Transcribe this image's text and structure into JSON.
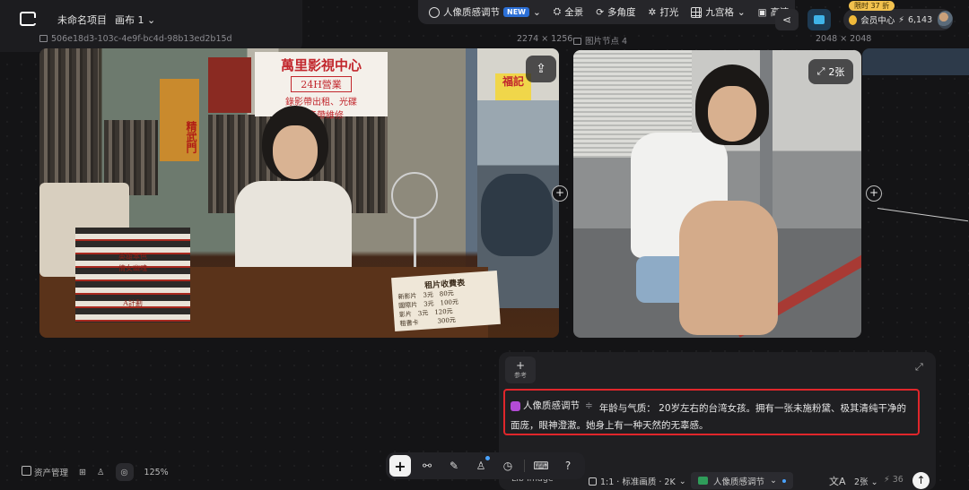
{
  "header": {
    "project_title": "未命名项目",
    "canvas_selector": "画布 1"
  },
  "toolbar": {
    "preset_label": "人像质感调节",
    "new_badge": "NEW",
    "items": [
      "全景",
      "多角度",
      "打光",
      "九宫格",
      "高清"
    ]
  },
  "account": {
    "promo": "限时 37 折",
    "vip_label": "会员中心",
    "points": "6,143"
  },
  "nodes": [
    {
      "id": "506e18d3-103c-4e9f-bc4d-98b13ed2b15d",
      "size": "2274 × 1256"
    },
    {
      "id": "图片节点 4",
      "size": "2048 × 2048",
      "count_label": "2张"
    }
  ],
  "scene1": {
    "sign_line1": "萬里影視中心",
    "sign_line2": "24H營業",
    "sign_line3": "錄影帶出租、光碟",
    "sign_line4": "錄音帶維修",
    "poster_text": "精武門",
    "card_title": "租片收費表",
    "card_rows": [
      "新影片　3元　80元",
      "國際片　3元　100元",
      "影片　3元　120元",
      "租書卡　　　300元"
    ],
    "tapes": [
      "英雄本色",
      "倩女幽魂",
      "",
      "",
      "A計劃"
    ],
    "shop_sign": "福記"
  },
  "prompt": {
    "reference_label": "参考",
    "tag_label": "人像质感调节",
    "text": "年龄与气质： 20岁左右的台湾女孩。拥有一张未施粉黛、极其清纯干净的面庞，眼神澄澈。她身上有一种天然的无辜感。"
  },
  "options": {
    "model": "Lib Image",
    "ratio": "1:1 · 标准画质 · 2K",
    "preset": "人像质感调节",
    "lang_icon": "文A",
    "count": "2张",
    "credits": "36"
  },
  "bottom_left": {
    "assets_label": "资产管理",
    "zoom": "125%"
  }
}
